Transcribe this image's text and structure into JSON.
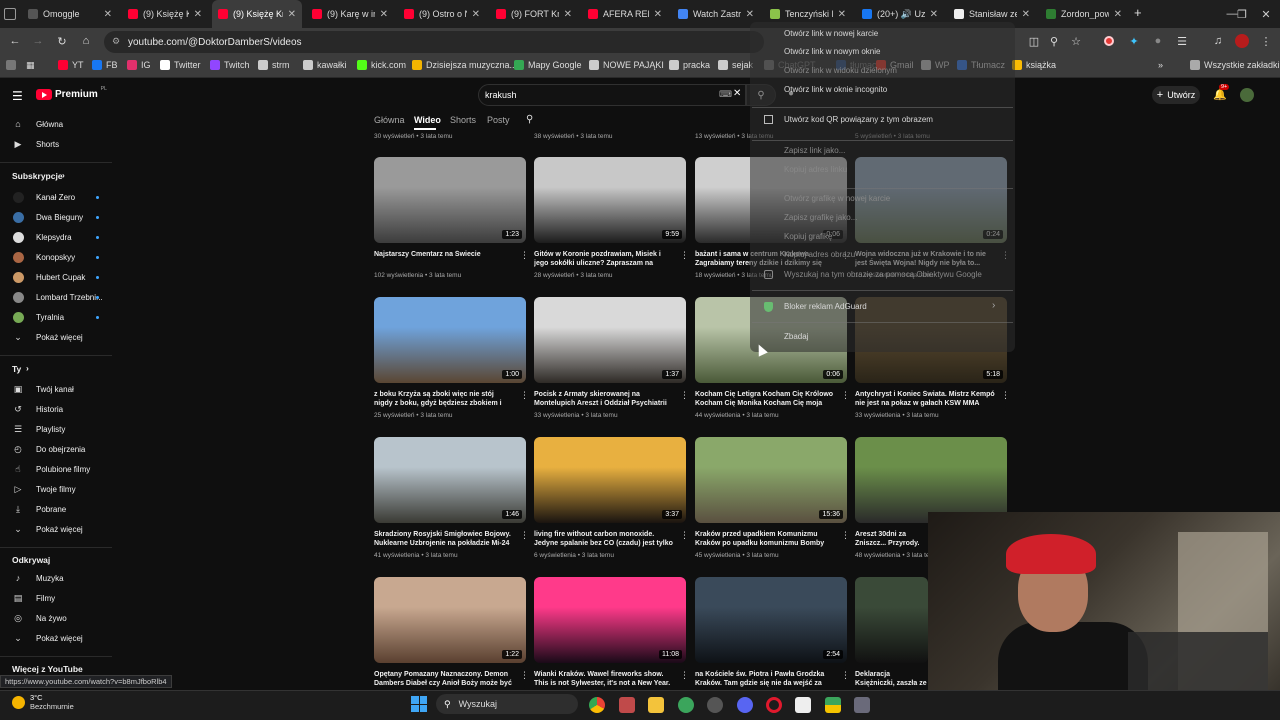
{
  "browser": {
    "tabs": [
      {
        "label": "Omoggle",
        "favicon_color": "#555"
      },
      {
        "label": "(9) Księżę Kr",
        "favicon_color": "#ff0033"
      },
      {
        "label": "(9) Księżę Kr",
        "favicon_color": "#ff0033"
      },
      {
        "label": "(9) Karę w in",
        "favicon_color": "#ff0033"
      },
      {
        "label": "(9) Ostro o N",
        "favicon_color": "#ff0033"
      },
      {
        "label": "(9) FORT Kra",
        "favicon_color": "#ff0033"
      },
      {
        "label": "AFERA REPR",
        "favicon_color": "#ff0033"
      },
      {
        "label": "Watch Zastr",
        "favicon_color": "#4285f4"
      },
      {
        "label": "Tenczyński P",
        "favicon_color": "#8bc34a"
      },
      {
        "label": "(20+) 🔊 Uz",
        "favicon_color": "#1877f2"
      },
      {
        "label": "Stanisław ze",
        "favicon_color": "#eeeeee"
      },
      {
        "label": "Zordon_pow",
        "favicon_color": "#2e7d32"
      }
    ],
    "new_tab_label": "+",
    "url": "youtube.com/@DoktorDamberS/videos",
    "bookmarks": [
      {
        "label": "YT",
        "icon": "youtube-icon",
        "color": "#ff0033"
      },
      {
        "label": "FB",
        "icon": "facebook-icon",
        "color": "#1877f2"
      },
      {
        "label": "IG",
        "icon": "instagram-icon",
        "color": "#e1306c"
      },
      {
        "label": "Twitter",
        "icon": "x-icon",
        "color": "#ffffff"
      },
      {
        "label": "Twitch",
        "icon": "twitch-icon",
        "color": "#9146ff"
      },
      {
        "label": "strm",
        "icon": "folder-icon",
        "color": "#ccc"
      },
      {
        "label": "kawałki",
        "icon": "folder-icon",
        "color": "#ccc"
      },
      {
        "label": "kick.com",
        "icon": "kick-icon",
        "color": "#53fc18"
      },
      {
        "label": "Dzisiejsza muzyczna...",
        "icon": "music-icon",
        "color": "#f4b400"
      },
      {
        "label": "Mapy Google",
        "icon": "maps-icon",
        "color": "#34a853"
      },
      {
        "label": "NOWE PAJĄKI",
        "icon": "folder-icon",
        "color": "#ccc"
      },
      {
        "label": "pracka",
        "icon": "folder-icon",
        "color": "#ccc"
      },
      {
        "label": "sejak",
        "icon": "folder-icon",
        "color": "#ccc"
      },
      {
        "label": "ChatGPT",
        "icon": "chatgpt-icon",
        "color": "#ccc"
      },
      {
        "label": "tłumacz",
        "icon": "translate-icon",
        "color": "#4285f4"
      },
      {
        "label": "Gmail",
        "icon": "gmail-icon",
        "color": "#ea4335"
      },
      {
        "label": "WP",
        "icon": "wp-icon",
        "color": "#ccc"
      },
      {
        "label": "Tłumacz",
        "icon": "translate-icon",
        "color": "#4285f4"
      },
      {
        "label": "książka",
        "icon": "book-icon",
        "color": "#fbbc04"
      }
    ],
    "all_bookmarks": "Wszystkie zakładki",
    "status_url": "https://www.youtube.com/watch?v=b8mJfboRlb4"
  },
  "youtube": {
    "logo_text": "Premium",
    "logo_region": "PL",
    "search_value": "krakush",
    "create_label": "Utwórz",
    "notification_count": "9+",
    "channel_tabs": [
      "Główna",
      "Wideo",
      "Shorts",
      "Posty"
    ],
    "sidebar": {
      "top": [
        {
          "label": "Główna",
          "icon": "home-icon"
        },
        {
          "label": "Shorts",
          "icon": "shorts-icon"
        }
      ],
      "subscriptions_heading": "Subskrypcje",
      "subscriptions": [
        {
          "label": "Kanał Zero",
          "color": "#222"
        },
        {
          "label": "Dwa Bieguny",
          "color": "#3a6ea5"
        },
        {
          "label": "Klepsydra",
          "color": "#ddd"
        },
        {
          "label": "Konopskyy",
          "color": "#a64"
        },
        {
          "label": "Hubert Cupak",
          "color": "#c96"
        },
        {
          "label": "Lombard Trzebni...",
          "color": "#888"
        },
        {
          "label": "Tyralnia",
          "color": "#7a5"
        }
      ],
      "show_more": "Pokaż więcej",
      "you_heading": "Ty",
      "you": [
        {
          "label": "Twój kanał",
          "icon": "channel-icon"
        },
        {
          "label": "Historia",
          "icon": "history-icon"
        },
        {
          "label": "Playlisty",
          "icon": "playlist-icon"
        },
        {
          "label": "Do obejrzenia",
          "icon": "clock-icon"
        },
        {
          "label": "Polubione filmy",
          "icon": "thumbs-up-icon"
        },
        {
          "label": "Twoje filmy",
          "icon": "video-icon"
        },
        {
          "label": "Pobrane",
          "icon": "download-icon"
        },
        {
          "label": "Pokaż więcej",
          "icon": "chevron-down-icon"
        }
      ],
      "explore_heading": "Odkrywaj",
      "explore": [
        {
          "label": "Muzyka",
          "icon": "music-icon"
        },
        {
          "label": "Filmy",
          "icon": "film-icon"
        },
        {
          "label": "Na żywo",
          "icon": "live-icon"
        },
        {
          "label": "Pokaż więcej",
          "icon": "chevron-down-icon"
        }
      ],
      "more_heading": "Więcej z YouTube"
    },
    "previous_row_meta": [
      "30 wyświetleń • 3 lata temu",
      "38 wyświetleń • 3 lata temu",
      "13 wyświetleń • 3 lata temu",
      "5 wyświetleń • 3 lata temu"
    ],
    "videos": [
      {
        "title": "Najstarszy Cmentarz na Świecie",
        "meta": "102 wyświetlenia • 3 lata temu",
        "duration": "1:23",
        "palette": [
          "#9a9a9a",
          "#3c3c3c"
        ]
      },
      {
        "title": "Gitów w Koronie pozdrawiam, Misiek i jego sokółki uliczne? Zapraszam na Błonia KS...",
        "meta": "28 wyświetleń • 3 lata temu",
        "duration": "9:59",
        "palette": [
          "#c8c8c8",
          "#1c1c1c"
        ]
      },
      {
        "title": "bażant i sama w centrum Krakowa Zagrabiamy tereny dzikie i dzikimy się że...",
        "meta": "18 wyświetleń • 3 lata temu",
        "duration": "0:06",
        "palette": [
          "#cfcfcf",
          "#2a2a2a"
        ]
      },
      {
        "title": "Wojna widoczna już w Krakowie i to nie jest Święta Wojna! Nigdy nie była to...",
        "meta": "15 wyświetleń • 3 lata temu",
        "duration": "0:24",
        "palette": [
          "#9fb3c8",
          "#6b7a5a"
        ]
      },
      {
        "title": "z boku Krzyża są zboki więc nie stój nigdy z boku, gdyż będziesz zbokiem i bez Boga!...",
        "meta": "25 wyświetleń • 3 lata temu",
        "duration": "1:00",
        "palette": [
          "#6fa3dc",
          "#5a4632"
        ]
      },
      {
        "title": "Pocisk z Armaty skierowanej na Montelupich Areszt i Oddział Psychiatrii Sądowej witają...",
        "meta": "33 wyświetlenia • 3 lata temu",
        "duration": "1:37",
        "palette": [
          "#d9d9d9",
          "#2e2a26"
        ]
      },
      {
        "title": "Kocham Cię Letigra Kocham Cię Królowo Kocham Cię Monika Kocham Cię moja Żon...",
        "meta": "44 wyświetlenia • 3 lata temu",
        "duration": "0:06",
        "palette": [
          "#b9c4a8",
          "#4a5a38"
        ]
      },
      {
        "title": "Antychryst i Koniec Świata. Mistrz Kempó nie jest na pokaz w gałach KSW MMA FEN...",
        "meta": "33 wyświetlenia • 3 lata temu",
        "duration": "5:18",
        "palette": [
          "#5a4a30",
          "#2a2418"
        ]
      },
      {
        "title": "Skradziony Rosyjski Śmigłowiec Bojowy. Nuklearne Uzbrojenie na pokładzie Mi-24 w...",
        "meta": "41 wyświetlenia • 3 lata temu",
        "duration": "1:46",
        "palette": [
          "#b8c4cc",
          "#3a3a34"
        ]
      },
      {
        "title": "living fire without carbon monoxide. Jedyne spalanie bez CO (czadu) jest tylko dzięki...",
        "meta": "6 wyświetlenia • 3 lata temu",
        "duration": "3:37",
        "palette": [
          "#e8b040",
          "#1a1410"
        ]
      },
      {
        "title": "Kraków przed upadkiem Komunizmu Kraków po upadku komunizmu Bomby Nuklearne i...",
        "meta": "45 wyświetlenia • 3 lata temu",
        "duration": "15:36",
        "palette": [
          "#8aa86a",
          "#5a5040"
        ]
      },
      {
        "title": "Areszt 30dni za Zniszcz... Przyrody. Kara dla mnie...",
        "meta": "48 wyświetlenia • 3 lata temu",
        "duration": "",
        "palette": [
          "#6b8f4a",
          "#2a2a2a"
        ]
      },
      {
        "title": "Opętany Pomazany Naznaczony. Demon Dambers Diabeł czy Anioł Boży może być z...",
        "meta": "",
        "duration": "1:22",
        "palette": [
          "#c8a890",
          "#5a4030"
        ]
      },
      {
        "title": "Wianki Kraków. Wawel fireworks show. This is not Sylwester, it's not a New Year.",
        "meta": "",
        "duration": "11:08",
        "palette": [
          "#ff3a8a",
          "#1a0a18"
        ]
      },
      {
        "title": "na Kościele św. Piotra i Pawła Grodzka Kraków. Tam gdzie się nie da wejść za żad...",
        "meta": "",
        "duration": "2:54",
        "palette": [
          "#3a4a5a",
          "#0e1216"
        ]
      },
      {
        "title": "Deklaracja Księżniczki, zaszła ze mną w ciążę.",
        "meta": "",
        "duration": "",
        "palette": [
          "#3a4a38",
          "#111111"
        ]
      }
    ]
  },
  "context_menu": {
    "items": [
      {
        "label": "Otwórz link w nowej karcie",
        "dim": false
      },
      {
        "label": "Otwórz link w nowym oknie",
        "dim": false
      },
      {
        "label": "Otwórz link w oknie incognito",
        "dim": false
      },
      {
        "label": "Utwórz kod QR powiązany z tym obrazem",
        "dim": false
      },
      {
        "label": "Zapisz link jako...",
        "dim": true
      },
      {
        "label": "Kopiuj adres linku",
        "dim": true
      },
      {
        "label": "Otwórz grafikę w nowej karcie",
        "dim": true
      },
      {
        "label": "Zapisz grafikę jako...",
        "dim": true
      },
      {
        "label": "Kopiuj grafikę",
        "dim": true
      },
      {
        "label": "Kopiuj adres obrazu",
        "dim": true
      },
      {
        "label": "Wyszukaj na tym obrazie za pomocą Obiektywu Google",
        "dim": true
      },
      {
        "label": "Bloker reklam AdGuard",
        "dim": false
      },
      {
        "label": "Zbadaj",
        "dim": false
      }
    ],
    "overlay_text": "Otwórz link w widoku dzielonym"
  },
  "taskbar": {
    "weather_temp": "3°C",
    "weather_desc": "Bezchmurnie",
    "search_placeholder": "Wyszukaj"
  }
}
